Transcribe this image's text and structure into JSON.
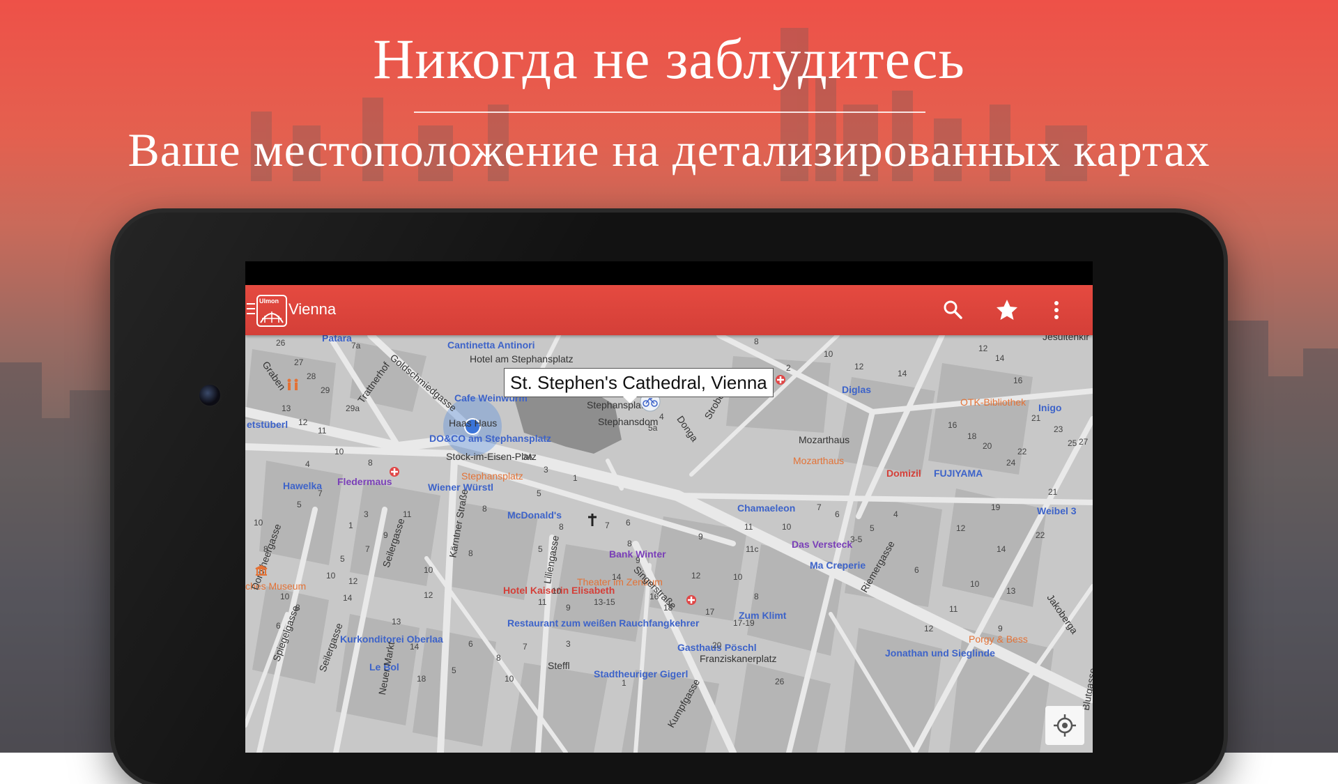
{
  "headline": {
    "title": "Никогда не заблудитесь",
    "subtitle": "Ваше местоположение на детализированных картах"
  },
  "app": {
    "logo_text": "Ulmon",
    "title": "Vienna",
    "actions": [
      "search-icon",
      "star-icon",
      "more-vert-icon"
    ]
  },
  "map": {
    "callout": "St. Stephen's Cathedral, Vienna",
    "labels": [
      {
        "text": "Cantinetta Antinori",
        "class": "poi-blue"
      },
      {
        "text": "Hotel am Stephansplatz",
        "class": "poi-dark"
      },
      {
        "text": "Cafe Weinwurm",
        "class": "poi-blue"
      },
      {
        "text": "Haas Haus",
        "class": "poi-dark"
      },
      {
        "text": "DO&CO am Stephansplatz",
        "class": "poi-blue"
      },
      {
        "text": "Stock-im-Eisen-Platz",
        "class": "poi-dark"
      },
      {
        "text": "Stephansplatz",
        "class": "poi-dark"
      },
      {
        "text": "Stephansdom",
        "class": "poi-dark"
      },
      {
        "text": "Stephansplatz",
        "class": "poi-orange"
      },
      {
        "text": "Wiener Würstl",
        "class": "poi-blue"
      },
      {
        "text": "Hawelka",
        "class": "poi-blue"
      },
      {
        "text": "Fledermaus",
        "class": "poi-purple"
      },
      {
        "text": "McDonald's",
        "class": "poi-blue"
      },
      {
        "text": "Bank Winter",
        "class": "poi-purple"
      },
      {
        "text": "Theater im Zentrum",
        "class": "poi-orange"
      },
      {
        "text": "Hotel Kaiserin Elisabeth",
        "class": "poi-red"
      },
      {
        "text": "Restaurant zum weißen Rauchfangkehrer",
        "class": "poi-blue"
      },
      {
        "text": "Kurkonditorei Oberlaa",
        "class": "poi-blue"
      },
      {
        "text": "Gasthaus Pöschl",
        "class": "poi-blue"
      },
      {
        "text": "Franziskanerplatz",
        "class": "poi-dark"
      },
      {
        "text": "Zum Klimt",
        "class": "poi-blue"
      },
      {
        "text": "Chamaeleon",
        "class": "poi-blue"
      },
      {
        "text": "Das Versteck",
        "class": "poi-purple"
      },
      {
        "text": "Ma Creperie",
        "class": "poi-blue"
      },
      {
        "text": "Mozarthaus",
        "class": "poi-dark"
      },
      {
        "text": "Mozarthaus",
        "class": "poi-orange"
      },
      {
        "text": "Domizil",
        "class": "poi-red"
      },
      {
        "text": "FUJIYAMA",
        "class": "poi-blue"
      },
      {
        "text": "Diglas",
        "class": "poi-blue"
      },
      {
        "text": "OTK-Bibliothek",
        "class": "poi-orange"
      },
      {
        "text": "Inigo",
        "class": "poi-blue"
      },
      {
        "text": "Weibel 3",
        "class": "poi-blue"
      },
      {
        "text": "Porgy & Bess",
        "class": "poi-orange"
      },
      {
        "text": "Jonathan und Sieglinde",
        "class": "poi-blue"
      },
      {
        "text": "Steffl",
        "class": "poi-dark"
      },
      {
        "text": "Le Bol",
        "class": "poi-blue"
      },
      {
        "text": "Stadtheuriger Gigerl",
        "class": "poi-blue"
      },
      {
        "text": "ches Museum",
        "class": "poi-orange"
      },
      {
        "text": "Patara",
        "class": "poi-blue"
      },
      {
        "text": "etstüberl",
        "class": "poi-blue"
      },
      {
        "text": "Jesuitenkir",
        "class": "poi-dark"
      }
    ],
    "streets": [
      {
        "text": "Graben"
      },
      {
        "text": "Trattnerhof"
      },
      {
        "text": "Goldschmiedgasse"
      },
      {
        "text": "Kärntner Straße"
      },
      {
        "text": "Seilergasse"
      },
      {
        "text": "Liliengasse"
      },
      {
        "text": "Singerstraße"
      },
      {
        "text": "Strobelgasse"
      },
      {
        "text": "Donga"
      },
      {
        "text": "Riemergasse"
      },
      {
        "text": "Jakoberga"
      },
      {
        "text": "Spiegelgasse"
      },
      {
        "text": "Neuer Markt"
      },
      {
        "text": "Dorotheergasse"
      },
      {
        "text": "Seilergasse"
      },
      {
        "text": "Kumpfgasse"
      },
      {
        "text": "Blutgasse"
      }
    ]
  }
}
